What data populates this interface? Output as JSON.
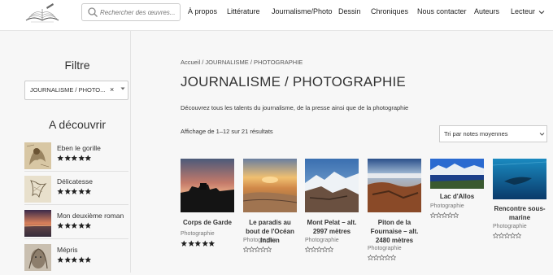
{
  "search": {
    "placeholder": "Rechercher des œuvres..."
  },
  "nav": [
    {
      "label": "À propos"
    },
    {
      "label": "Littérature"
    },
    {
      "label": "Journalisme/Photo"
    },
    {
      "label": "Dessin"
    },
    {
      "label": "Chroniques"
    },
    {
      "label": "Nous contacter"
    },
    {
      "label": "Auteurs"
    },
    {
      "label": "Lecteur"
    }
  ],
  "sidebar": {
    "filter_title": "Filtre",
    "filter_value": "JOURNALISME / PHOTO...",
    "filter_clear": "×",
    "discover_title": "A découvrir",
    "items": [
      {
        "name": "Eben le gorille",
        "rating": 5
      },
      {
        "name": "Délicatesse",
        "rating": 5
      },
      {
        "name": "Mon deuxième roman",
        "rating": 5
      },
      {
        "name": "Mépris",
        "rating": 5
      }
    ]
  },
  "main": {
    "breadcrumb": "Accueil / JOURNALISME / PHOTOGRAPHIE",
    "title": "JOURNALISME / PHOTOGRAPHIE",
    "description": "Découvrez tous les talents du journalisme, de la presse ainsi que de la photographie",
    "result_count": "Affichage de 1–12 sur 21 résultats",
    "sort_value": "Tri par notes moyennes"
  },
  "products": [
    {
      "title": "Corps de Garde",
      "category": "Photographie",
      "rating": 5
    },
    {
      "title": "Le paradis au bout de l'Océan Indien",
      "category": "Photographie",
      "rating": 0
    },
    {
      "title": "Mont Pelat – alt. 2997 mètres",
      "category": "Photographie",
      "rating": 0
    },
    {
      "title": "Piton de la Fournaise – alt. 2480 mètres",
      "category": "Photographie",
      "rating": 0
    },
    {
      "title": "Lac d'Allos",
      "category": "Photographie",
      "rating": 0
    },
    {
      "title": "Rencontre sous-marine",
      "category": "Photographie",
      "rating": 0
    }
  ],
  "colors": {
    "star": "#222222",
    "star_empty_stroke": "#555555"
  }
}
